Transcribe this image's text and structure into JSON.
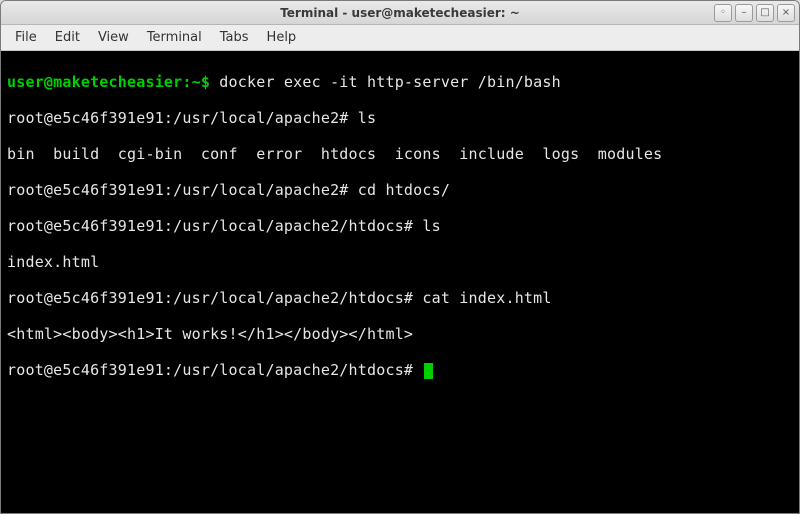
{
  "titlebar": {
    "title": "Terminal - user@maketecheasier: ~"
  },
  "window_controls": {
    "stick": "◦",
    "minimize": "–",
    "maximize": "□",
    "close": "×"
  },
  "menubar": {
    "file": "File",
    "edit": "Edit",
    "view": "View",
    "terminal": "Terminal",
    "tabs": "Tabs",
    "help": "Help"
  },
  "term": {
    "l1_prompt": "user@maketecheasier:~$",
    "l1_cmd": " docker exec -it http-server /bin/bash",
    "l2": "root@e5c46f391e91:/usr/local/apache2# ls",
    "l3": "bin  build  cgi-bin  conf  error  htdocs  icons  include  logs  modules",
    "l4": "root@e5c46f391e91:/usr/local/apache2# cd htdocs/",
    "l5": "root@e5c46f391e91:/usr/local/apache2/htdocs# ls",
    "l6": "index.html",
    "l7": "root@e5c46f391e91:/usr/local/apache2/htdocs# cat index.html",
    "l8": "<html><body><h1>It works!</h1></body></html>",
    "l9": "root@e5c46f391e91:/usr/local/apache2/htdocs# "
  }
}
